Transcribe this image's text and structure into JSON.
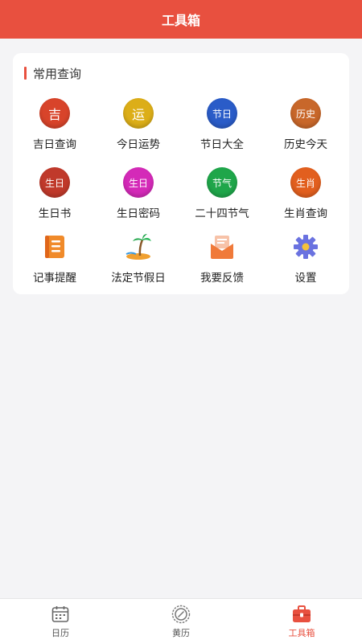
{
  "header": {
    "title": "工具箱"
  },
  "section": {
    "title": "常用查询"
  },
  "colors": {
    "accent": "#e8503f"
  },
  "tools": [
    {
      "label": "吉日查询",
      "glyph": "吉",
      "icon": "lucky-day-icon",
      "color": "#d8442a"
    },
    {
      "label": "今日运势",
      "glyph": "运",
      "icon": "fortune-icon",
      "color": "#e0b21a"
    },
    {
      "label": "节日大全",
      "glyph": "节日",
      "icon": "festival-icon",
      "color": "#2a5cc8"
    },
    {
      "label": "历史今天",
      "glyph": "历史",
      "icon": "history-icon",
      "color": "#c8672a"
    },
    {
      "label": "生日书",
      "glyph": "生日",
      "icon": "birthday-book-icon",
      "color": "#c0392b"
    },
    {
      "label": "生日密码",
      "glyph": "生日",
      "icon": "birthday-code-icon",
      "color": "#d42ab8"
    },
    {
      "label": "二十四节气",
      "glyph": "节气",
      "icon": "solar-terms-icon",
      "color": "#1fa64a"
    },
    {
      "label": "生肖查询",
      "glyph": "生肖",
      "icon": "zodiac-icon",
      "color": "#e25f1e"
    },
    {
      "label": "记事提醒",
      "glyph": "",
      "icon": "notebook-icon",
      "color": "#f08a2a"
    },
    {
      "label": "法定节假日",
      "glyph": "",
      "icon": "holiday-beach-icon",
      "color": "#f0a030"
    },
    {
      "label": "我要反馈",
      "glyph": "",
      "icon": "feedback-envelope-icon",
      "color": "#f07a3a"
    },
    {
      "label": "设置",
      "glyph": "",
      "icon": "settings-gear-icon",
      "color": "#6a72e0"
    }
  ],
  "tabbar": {
    "items": [
      {
        "label": "日历",
        "icon": "calendar-icon"
      },
      {
        "label": "黄历",
        "icon": "almanac-icon"
      },
      {
        "label": "工具箱",
        "icon": "toolbox-icon"
      }
    ],
    "active_index": 2
  }
}
